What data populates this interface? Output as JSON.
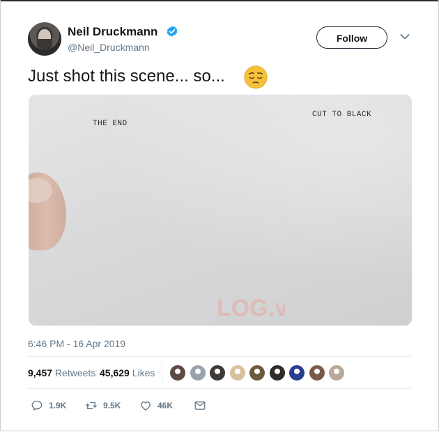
{
  "tweet": {
    "author_name": "Neil Druckmann",
    "author_handle": "@Neil_Druckmann",
    "follow_label": "Follow",
    "text": "Just shot this scene... so...",
    "emoji": "pensive-face-emoji",
    "timestamp": "6:46 PM - 16 Apr 2019"
  },
  "photo": {
    "left_text": "THE END",
    "right_text": "CUT TO BLACK",
    "watermark": "LOG.vn"
  },
  "stats": {
    "retweets_count": "9,457",
    "retweets_label": "Retweets",
    "likes_count": "45,629",
    "likes_label": "Likes"
  },
  "likers": [
    {
      "color": "#5b4b44"
    },
    {
      "color": "#9aa3ab"
    },
    {
      "color": "#3e3a37"
    },
    {
      "color": "#d8c19a"
    },
    {
      "color": "#6b5a3f"
    },
    {
      "color": "#2f2b29"
    },
    {
      "color": "#2c3e8f"
    },
    {
      "color": "#7a5a4a"
    },
    {
      "color": "#b9a99a"
    }
  ],
  "actions": {
    "reply_count": "1.9K",
    "retweet_count": "9.5K",
    "like_count": "46K"
  },
  "icons": [
    "verified-badge-icon",
    "chevron-down-icon",
    "reply-icon",
    "retweet-icon",
    "heart-icon",
    "direct-message-icon"
  ],
  "colors": {
    "verified": "#1da1f2",
    "text": "#14171a",
    "muted": "#657786"
  }
}
